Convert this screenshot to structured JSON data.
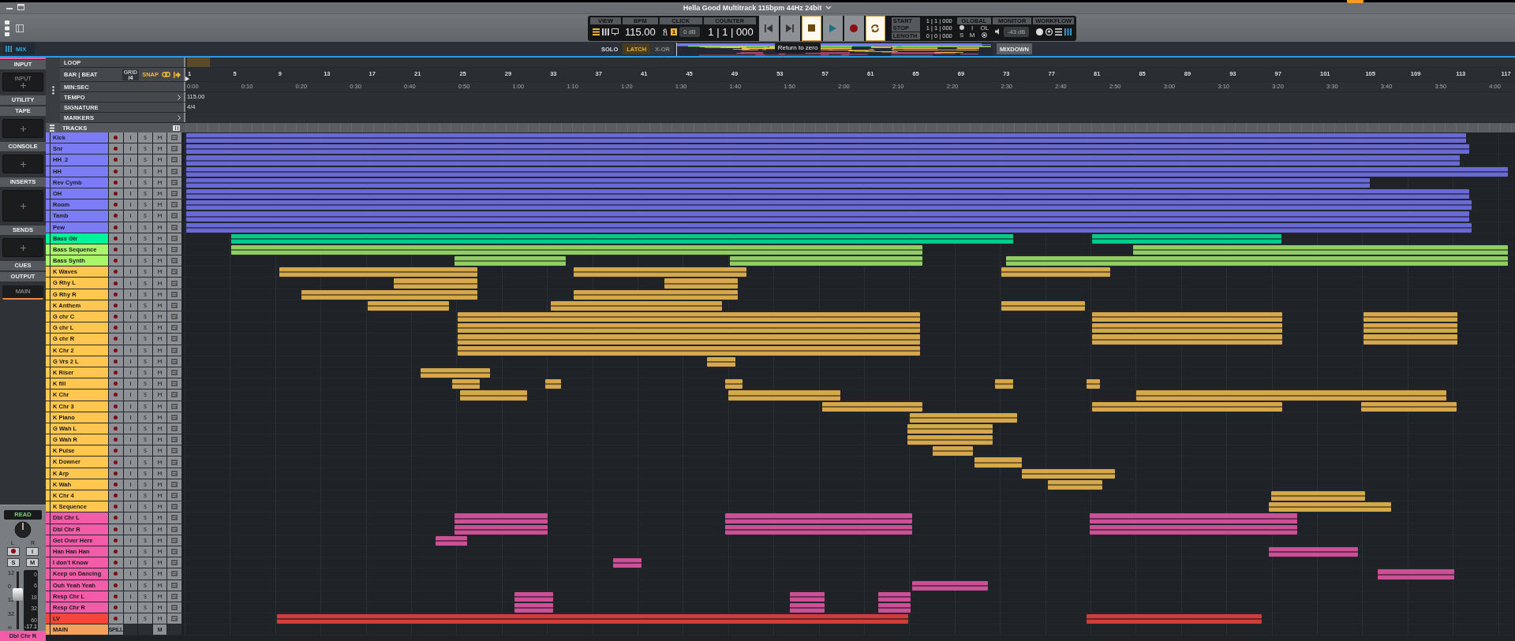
{
  "window": {
    "title": "Hella Good Multitrack 115bpm 44Hz 24bit"
  },
  "transport": {
    "view_label": "VIEW",
    "bpm_label": "BPM",
    "bpm": "115.00",
    "click_label": "CLICK",
    "click_badge": "1",
    "click_level": "0 dB",
    "counter_label": "COUNTER",
    "counter": "1 | 1 | 000",
    "buttons": [
      {
        "kind": "rewind",
        "active": false
      },
      {
        "kind": "forward",
        "active": false
      },
      {
        "kind": "stop",
        "active": true
      },
      {
        "kind": "play",
        "active": false
      },
      {
        "kind": "record",
        "active": false
      },
      {
        "kind": "loop",
        "active": true
      }
    ],
    "tooltip": "Return to zero",
    "locators": [
      {
        "label": "START",
        "value": "1 | 1 | 000"
      },
      {
        "label": "STOP",
        "value": "1 | 1 | 000"
      },
      {
        "label": "LENGTH",
        "value": "0 | 0 | 000"
      }
    ],
    "global_label": "GLOBAL",
    "global_input": "I",
    "global_overload": "OL",
    "global_solo": "S",
    "global_mute": "M",
    "monitor_label": "MONITOR",
    "monitor_level": "-43 dB",
    "workflow_label": "WORKFLOW"
  },
  "mode_bar": {
    "tab": "MIX",
    "solo_label": "SOLO",
    "solo_modes": [
      {
        "label": "LATCH",
        "selected": true
      },
      {
        "label": "X-OR",
        "selected": false
      }
    ],
    "mixdown": "MIXDOWN"
  },
  "inspector": {
    "sections": [
      {
        "kind": "header",
        "label": "INPUT"
      },
      {
        "kind": "slot",
        "label": "INPUT"
      },
      {
        "kind": "header",
        "label": "UTILITY"
      },
      {
        "kind": "header",
        "label": "TAPE"
      },
      {
        "kind": "slot"
      },
      {
        "kind": "header",
        "label": "CONSOLE"
      },
      {
        "kind": "slot"
      },
      {
        "kind": "header",
        "label": "INSERTS"
      },
      {
        "kind": "large-slot"
      },
      {
        "kind": "header",
        "label": "SENDS"
      },
      {
        "kind": "slot"
      },
      {
        "kind": "header",
        "label": "CUES"
      },
      {
        "kind": "header",
        "label": "OUTPUT"
      },
      {
        "kind": "output",
        "label": "MAIN"
      }
    ]
  },
  "channel_strip": {
    "automation": "READ",
    "pan_left": "L",
    "pan_right": "R",
    "input": "I",
    "solo": "S",
    "mute": "M",
    "level": 0.6,
    "fader_scale": [
      "12",
      "0",
      "12",
      "32",
      "∞"
    ],
    "meter_scale": [
      "0",
      "6",
      "18",
      "32",
      "60"
    ],
    "peak": "-17.1",
    "name": "Dbl Chr R",
    "color": "#f25ca8"
  },
  "header_rows": {
    "loop": "LOOP",
    "bar_beat": "BAR | BEAT",
    "grid_label": "GRID",
    "grid_value": "/4",
    "snap": "SNAP",
    "min_sec": "MIN:SEC",
    "tempo": "TEMPO",
    "signature": "SIGNATURE",
    "markers": "MARKERS",
    "tracks": "TRACKS"
  },
  "ruler": {
    "bars": [
      "1",
      "5",
      "9",
      "13",
      "17",
      "21",
      "25",
      "29",
      "33",
      "37",
      "41",
      "45",
      "49",
      "53",
      "57",
      "61",
      "65",
      "69",
      "73",
      "77",
      "81",
      "85",
      "89",
      "93",
      "97",
      "101",
      "105",
      "109",
      "113",
      "117"
    ],
    "times": [
      "0:00",
      "0:10",
      "0:20",
      "0:30",
      "0:40",
      "0:50",
      "1:00",
      "1:10",
      "1:20",
      "1:30",
      "1:40",
      "1:50",
      "2:00",
      "2:10",
      "2:20",
      "2:30",
      "2:40",
      "2:50",
      "3:00",
      "3:10",
      "3:20",
      "3:30",
      "3:40",
      "3:50",
      "4:00"
    ],
    "tempo": "115.00",
    "signature": "4/4"
  },
  "tracks": [
    {
      "kind": "audio",
      "name": "Kick",
      "color": "#7b7cf6",
      "armed": false
    },
    {
      "kind": "audio",
      "name": "Snr",
      "color": "#7b7cf6",
      "armed": false
    },
    {
      "kind": "audio",
      "name": "HH_2",
      "color": "#7b7cf6",
      "armed": false
    },
    {
      "kind": "audio",
      "name": "HH",
      "color": "#7b7cf6",
      "armed": false
    },
    {
      "kind": "audio",
      "name": "Rev Cymb",
      "color": "#7b7cf6",
      "armed": false
    },
    {
      "kind": "audio",
      "name": "OH",
      "color": "#7b7cf6",
      "armed": false
    },
    {
      "kind": "audio",
      "name": "Room",
      "color": "#7b7cf6",
      "armed": false
    },
    {
      "kind": "audio",
      "name": "Tamb",
      "color": "#7b7cf6",
      "armed": false
    },
    {
      "kind": "audio",
      "name": "Pew",
      "color": "#7b7cf6",
      "armed": false
    },
    {
      "kind": "audio",
      "name": "Bass Gtr",
      "color": "#00f29a",
      "armed": false
    },
    {
      "kind": "audio",
      "name": "Bass Sequence",
      "color": "#a9f56c",
      "armed": false
    },
    {
      "kind": "audio",
      "name": "Bass Synth",
      "color": "#a9f56c",
      "armed": false
    },
    {
      "kind": "audio",
      "name": "K Waves",
      "color": "#ffc74f",
      "armed": false
    },
    {
      "kind": "audio",
      "name": "G Rhy L",
      "color": "#ffc74f",
      "armed": false
    },
    {
      "kind": "audio",
      "name": "G Rhy R",
      "color": "#ffc74f",
      "armed": false
    },
    {
      "kind": "audio",
      "name": "K Anthem",
      "color": "#ffc74f",
      "armed": false
    },
    {
      "kind": "audio",
      "name": "G chr C",
      "color": "#ffc74f",
      "armed": false
    },
    {
      "kind": "audio",
      "name": "G chr L",
      "color": "#ffc74f",
      "armed": false
    },
    {
      "kind": "audio",
      "name": "G chr R",
      "color": "#ffc74f",
      "armed": false
    },
    {
      "kind": "audio",
      "name": "K Chr 2",
      "color": "#ffc74f",
      "armed": false
    },
    {
      "kind": "audio",
      "name": "G Vrs 2 L",
      "color": "#ffc74f",
      "armed": false
    },
    {
      "kind": "audio",
      "name": "K Riser",
      "color": "#ffc74f",
      "armed": false
    },
    {
      "kind": "audio",
      "name": "K fill",
      "color": "#ffc74f",
      "armed": false
    },
    {
      "kind": "audio",
      "name": "K Chr",
      "color": "#ffc74f",
      "armed": false
    },
    {
      "kind": "audio",
      "name": "K Chr 3",
      "color": "#ffc74f",
      "armed": false
    },
    {
      "kind": "audio",
      "name": "K Piano",
      "color": "#ffc74f",
      "armed": false
    },
    {
      "kind": "audio",
      "name": "G Wah L",
      "color": "#ffc74f",
      "armed": false
    },
    {
      "kind": "audio",
      "name": "G Wah R",
      "color": "#ffc74f",
      "armed": false
    },
    {
      "kind": "audio",
      "name": "K Pulse",
      "color": "#ffc74f",
      "armed": false
    },
    {
      "kind": "audio",
      "name": "K Downer",
      "color": "#ffc74f",
      "armed": false
    },
    {
      "kind": "audio",
      "name": "K Arp",
      "color": "#ffc74f",
      "armed": false
    },
    {
      "kind": "audio",
      "name": "K Wah",
      "color": "#ffc74f",
      "armed": false
    },
    {
      "kind": "audio",
      "name": "K Chr 4",
      "color": "#ffc74f",
      "armed": false
    },
    {
      "kind": "audio",
      "name": "K Sequence",
      "color": "#ffc74f",
      "armed": false
    },
    {
      "kind": "audio",
      "name": "Dbl Chr L",
      "color": "#f25ca8",
      "armed": false
    },
    {
      "kind": "audio",
      "name": "Dbl Chr R",
      "color": "#f25ca8",
      "armed": false
    },
    {
      "kind": "audio",
      "name": "Get Over Here",
      "color": "#f25ca8",
      "armed": false
    },
    {
      "kind": "audio",
      "name": "Han Han Han",
      "color": "#f25ca8",
      "armed": false
    },
    {
      "kind": "audio",
      "name": "I don't Know",
      "color": "#f25ca8",
      "armed": false
    },
    {
      "kind": "audio",
      "name": "Keep on Dancing",
      "color": "#f25ca8",
      "armed": false
    },
    {
      "kind": "audio",
      "name": "Ouh Yeah Yeah",
      "color": "#f25ca8",
      "armed": false
    },
    {
      "kind": "audio",
      "name": "Resp Chr L",
      "color": "#f25ca8",
      "armed": false
    },
    {
      "kind": "audio",
      "name": "Resp Chr R",
      "color": "#f25ca8",
      "armed": false
    },
    {
      "kind": "audio",
      "name": "LV",
      "color": "#f5463e",
      "armed": false
    },
    {
      "kind": "bus",
      "name": "MAIN",
      "color": "#f4a15c",
      "spill": "SPILL",
      "mute": "M"
    }
  ]
}
